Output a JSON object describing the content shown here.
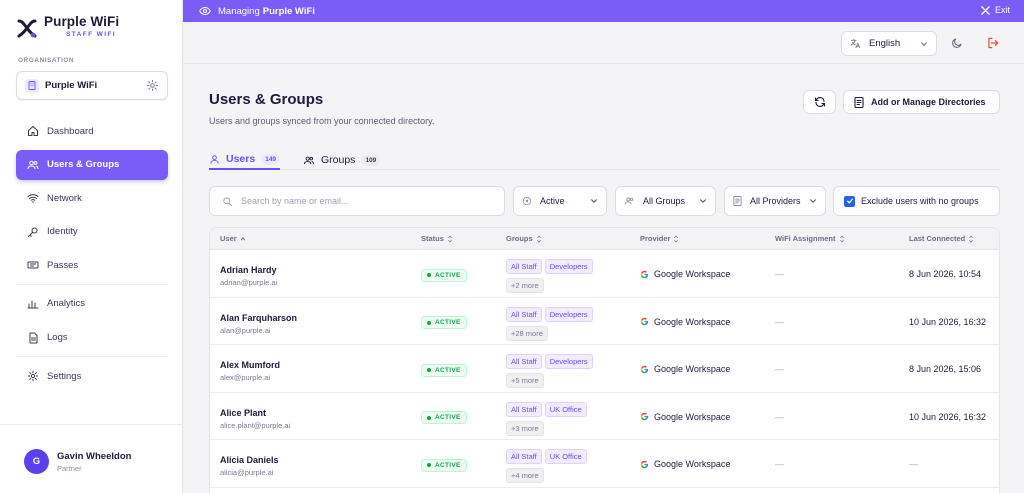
{
  "brand": {
    "name": "Purple WiFi",
    "subtitle": "STAFF WIFI"
  },
  "organisation": {
    "label": "ORGANISATION",
    "name": "Purple WiFi"
  },
  "nav": {
    "dashboard": "Dashboard",
    "users_groups": "Users & Groups",
    "network": "Network",
    "identity": "Identity",
    "passes": "Passes",
    "analytics": "Analytics",
    "logs": "Logs",
    "settings": "Settings"
  },
  "user": {
    "initial": "G",
    "name": "Gavin Wheeldon",
    "role": "Partner"
  },
  "banner": {
    "prefix": "Managing",
    "org": "Purple WiFi",
    "exit": "Exit"
  },
  "topbar": {
    "language": "English"
  },
  "page": {
    "title": "Users & Groups",
    "subtitle": "Users and groups synced from your connected directory.",
    "manage_button": "Add or Manage Directories"
  },
  "tabs": {
    "users": {
      "label": "Users",
      "count": "149"
    },
    "groups": {
      "label": "Groups",
      "count": "109"
    }
  },
  "filters": {
    "search_placeholder": "Search by name or email...",
    "status": "Active",
    "groups": "All Groups",
    "providers": "All Providers",
    "exclude_label": "Exclude users with no groups"
  },
  "table": {
    "headers": {
      "user": "User",
      "status": "Status",
      "groups": "Groups",
      "provider": "Provider",
      "wifi": "WiFi Assignment",
      "last": "Last Connected"
    },
    "rows": [
      {
        "name": "Adrian Hardy",
        "email": "adrian@purple.ai",
        "status": "ACTIVE",
        "group1": "All Staff",
        "group2": "Developers",
        "more": "+2 more",
        "provider": "Google Workspace",
        "wifi": "—",
        "last": "8 Jun 2026, 10:54"
      },
      {
        "name": "Alan Farquharson",
        "email": "alan@purple.ai",
        "status": "ACTIVE",
        "group1": "All Staff",
        "group2": "Developers",
        "more": "+28 more",
        "provider": "Google Workspace",
        "wifi": "—",
        "last": "10 Jun 2026, 16:32"
      },
      {
        "name": "Alex Mumford",
        "email": "alex@purple.ai",
        "status": "ACTIVE",
        "group1": "All Staff",
        "group2": "Developers",
        "more": "+5 more",
        "provider": "Google Workspace",
        "wifi": "—",
        "last": "8 Jun 2026, 15:06"
      },
      {
        "name": "Alice Plant",
        "email": "alice.plant@purple.ai",
        "status": "ACTIVE",
        "group1": "All Staff",
        "group2": "UK Office",
        "more": "+3 more",
        "provider": "Google Workspace",
        "wifi": "—",
        "last": "10 Jun 2026, 16:32"
      },
      {
        "name": "Alicia Daniels",
        "email": "alicia@purple.ai",
        "status": "ACTIVE",
        "group1": "All Staff",
        "group2": "UK Office",
        "more": "+4 more",
        "provider": "Google Workspace",
        "wifi": "—",
        "last": "—"
      }
    ]
  },
  "colors": {
    "accent": "#7a5cf7",
    "active_green": "#16a34a",
    "checkbox_blue": "#2563eb"
  }
}
